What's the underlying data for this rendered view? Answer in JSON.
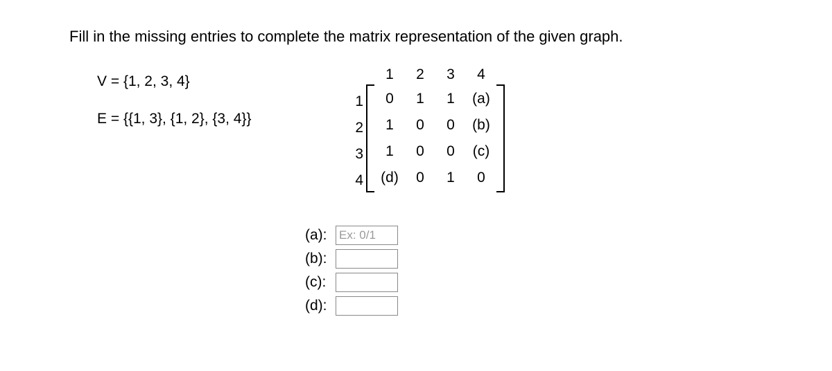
{
  "instruction": "Fill in the missing entries to complete the matrix representation of the given graph.",
  "vertex_set": "V = {1, 2, 3, 4}",
  "edge_set": "E = {{1, 3}, {1, 2}, {3, 4}}",
  "matrix": {
    "col_headers": [
      "1",
      "2",
      "3",
      "4"
    ],
    "row_headers": [
      "1",
      "2",
      "3",
      "4"
    ],
    "rows": [
      [
        "0",
        "1",
        "1",
        "(a)"
      ],
      [
        "1",
        "0",
        "0",
        "(b)"
      ],
      [
        "1",
        "0",
        "0",
        "(c)"
      ],
      [
        "(d)",
        "0",
        "1",
        "0"
      ]
    ]
  },
  "inputs": {
    "a": {
      "label": "(a):",
      "placeholder": "Ex: 0/1",
      "value": ""
    },
    "b": {
      "label": "(b):",
      "placeholder": "",
      "value": ""
    },
    "c": {
      "label": "(c):",
      "placeholder": "",
      "value": ""
    },
    "d": {
      "label": "(d):",
      "placeholder": "",
      "value": ""
    }
  }
}
